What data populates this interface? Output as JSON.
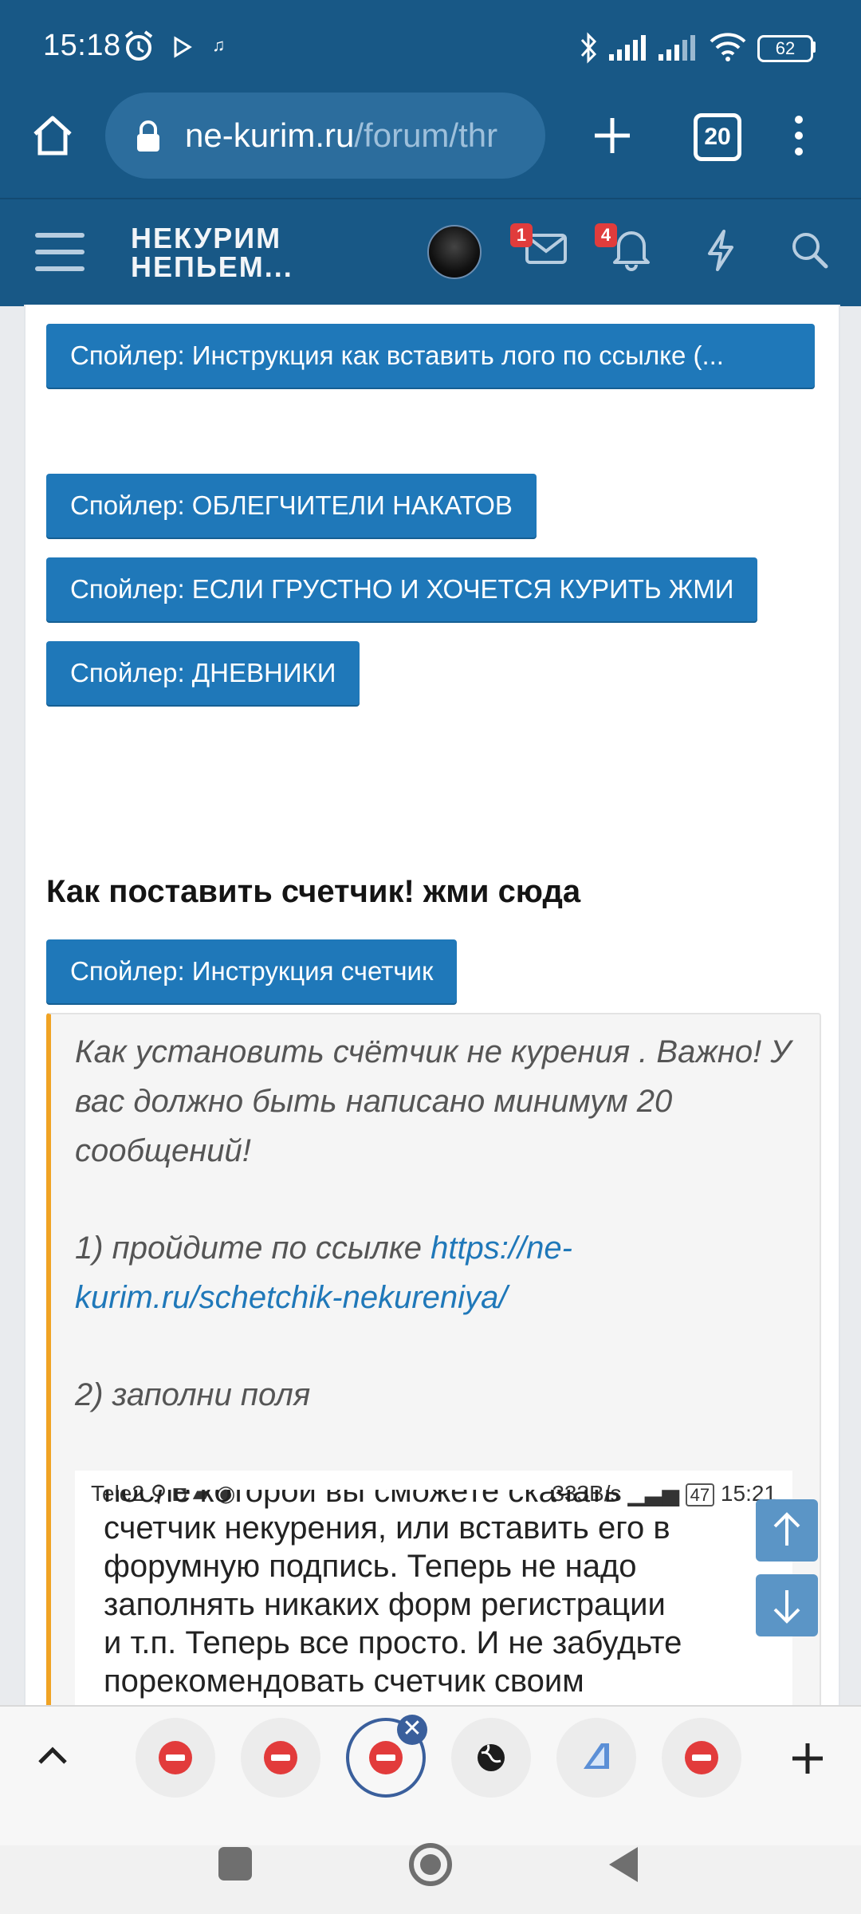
{
  "status_bar": {
    "time": "15:18",
    "battery": "62"
  },
  "browser": {
    "url_domain": "ne-kurim.ru",
    "url_path": "/forum/thr",
    "tab_count": "20"
  },
  "forum": {
    "logo_line1": "НЕКУРИМ",
    "logo_line2": "НЕПЬЕМ...",
    "messages_badge": "1",
    "alerts_badge": "4"
  },
  "content": {
    "spoilers": [
      "Спойлер: Инструкция как вставить лого по ссылке (...",
      "Спойлер: ОБЛЕГЧИТЕЛИ НАКАТОВ",
      "Спойлер: ЕСЛИ ГРУСТНО И ХОЧЕТСЯ КУРИТЬ ЖМИ",
      "Спойлер: ДНЕВНИКИ"
    ],
    "counter_heading": "Как поставить счетчик! жми сюда",
    "counter_spoiler": "Спойлер: Инструкция счетчик",
    "quote": {
      "intro": "Как установить счётчик не курения . Важно! У вас должно быть написано минимум 20 сообщений!",
      "step1_prefix": "1) пройдите по ссылке ",
      "step1_link": "https://ne-kurim.ru/schetchik-nekureniya/",
      "step2": "2) заполни поля"
    },
    "inner_screenshot": {
      "carrier": "Tele2",
      "net_speed": "333B/s",
      "battery": "47",
      "time": "15:21",
      "text_top_cut": "после которой вы сможете скачать",
      "text_lines": [
        "счетчик некурения, или вставить его в",
        "форумную подпись. Теперь не надо",
        "заполнять никаких форм регистрации",
        "и т.п. Теперь все просто. И не забудьте"
      ],
      "text_bottom_cut": "порекомендовать счетчик своим"
    }
  },
  "colors": {
    "header_blue": "#185886",
    "spoiler_blue": "#1f78b9",
    "quote_accent": "#f0a324",
    "badge_red": "#e03c3c"
  }
}
